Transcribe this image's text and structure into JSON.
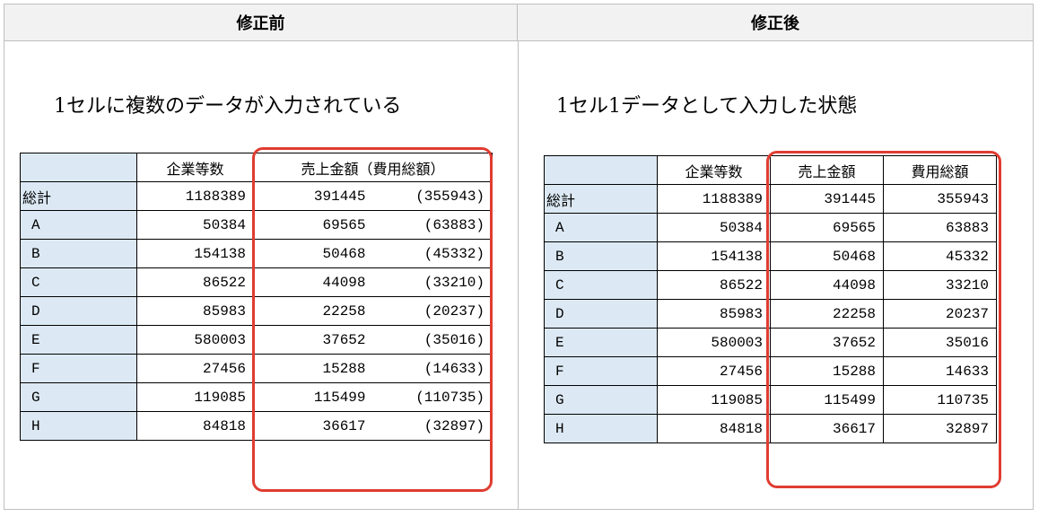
{
  "headers": {
    "before": "修正前",
    "after": "修正後"
  },
  "captions": {
    "before": "1セルに複数のデータが入力されている",
    "after": "1セル1データとして入力した状態"
  },
  "before_table": {
    "header_companies": "企業等数",
    "header_sales_costs": "売上金額（費用総額）",
    "rows": [
      {
        "label": "総計",
        "companies": "1188389",
        "sales": "391445",
        "costs": "(355943)"
      },
      {
        "label": "A",
        "companies": "50384",
        "sales": "69565",
        "costs": "(63883)"
      },
      {
        "label": "B",
        "companies": "154138",
        "sales": "50468",
        "costs": "(45332)"
      },
      {
        "label": "C",
        "companies": "86522",
        "sales": "44098",
        "costs": "(33210)"
      },
      {
        "label": "D",
        "companies": "85983",
        "sales": "22258",
        "costs": "(20237)"
      },
      {
        "label": "E",
        "companies": "580003",
        "sales": "37652",
        "costs": "(35016)"
      },
      {
        "label": "F",
        "companies": "27456",
        "sales": "15288",
        "costs": "(14633)"
      },
      {
        "label": "G",
        "companies": "119085",
        "sales": "115499",
        "costs": "(110735)"
      },
      {
        "label": "H",
        "companies": "84818",
        "sales": "36617",
        "costs": "(32897)"
      }
    ]
  },
  "after_table": {
    "header_companies": "企業等数",
    "header_sales": "売上金額",
    "header_costs": "費用総額",
    "rows": [
      {
        "label": "総計",
        "companies": "1188389",
        "sales": "391445",
        "costs": "355943"
      },
      {
        "label": "A",
        "companies": "50384",
        "sales": "69565",
        "costs": "63883"
      },
      {
        "label": "B",
        "companies": "154138",
        "sales": "50468",
        "costs": "45332"
      },
      {
        "label": "C",
        "companies": "86522",
        "sales": "44098",
        "costs": "33210"
      },
      {
        "label": "D",
        "companies": "85983",
        "sales": "22258",
        "costs": "20237"
      },
      {
        "label": "E",
        "companies": "580003",
        "sales": "37652",
        "costs": "35016"
      },
      {
        "label": "F",
        "companies": "27456",
        "sales": "15288",
        "costs": "14633"
      },
      {
        "label": "G",
        "companies": "119085",
        "sales": "115499",
        "costs": "110735"
      },
      {
        "label": "H",
        "companies": "84818",
        "sales": "36617",
        "costs": "32897"
      }
    ]
  },
  "colors": {
    "stub": "#dce9f4",
    "highlight": "#e03c31",
    "header_bg": "#f2f2f2"
  }
}
